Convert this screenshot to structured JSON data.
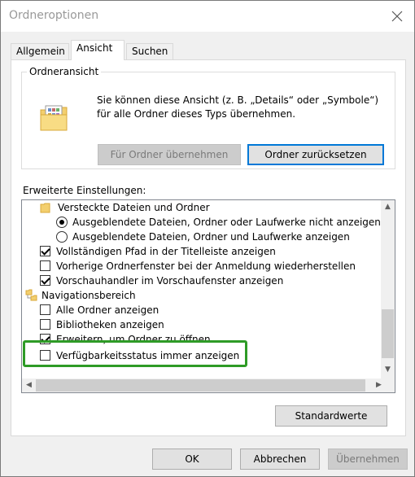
{
  "window": {
    "title": "Ordneroptionen"
  },
  "tabs": [
    {
      "label": "Allgemein"
    },
    {
      "label": "Ansicht"
    },
    {
      "label": "Suchen"
    }
  ],
  "folder_view": {
    "label": "Ordneransicht",
    "desc1": "Sie können diese Ansicht (z. B. „Details“ oder „Symbole“)",
    "desc2": "für alle Ordner dieses Typs übernehmen.",
    "apply_btn": "Für Ordner übernehmen",
    "reset_btn": "Ordner zurücksetzen"
  },
  "advanced": {
    "label": "Erweiterte Einstellungen:",
    "items": [
      {
        "type": "folder",
        "text": "Versteckte Dateien und Ordner"
      },
      {
        "type": "radio",
        "checked": true,
        "text": "Ausgeblendete Dateien, Ordner oder Laufwerke nicht anzeigen"
      },
      {
        "type": "radio",
        "checked": false,
        "text": "Ausgeblendete Dateien, Ordner und Laufwerke anzeigen"
      },
      {
        "type": "checkbox",
        "checked": true,
        "text": "Vollständigen Pfad in der Titelleiste anzeigen"
      },
      {
        "type": "checkbox",
        "checked": false,
        "text": "Vorherige Ordnerfenster bei der Anmeldung wiederherstellen"
      },
      {
        "type": "checkbox",
        "checked": true,
        "text": "Vorschauhandler im Vorschaufenster anzeigen"
      },
      {
        "type": "folder",
        "text": "Navigationsbereich"
      },
      {
        "type": "checkbox",
        "checked": false,
        "text": "Alle Ordner anzeigen"
      },
      {
        "type": "checkbox",
        "checked": false,
        "text": "Bibliotheken anzeigen"
      },
      {
        "type": "checkbox",
        "checked": true,
        "text": "Erweitern, um Ordner zu öffnen"
      },
      {
        "type": "checkbox",
        "checked": false,
        "text": "Verfügbarkeitsstatus immer anzeigen"
      }
    ]
  },
  "buttons": {
    "defaults": "Standardwerte",
    "ok": "OK",
    "cancel": "Abbrechen",
    "apply": "Übernehmen"
  },
  "colors": {
    "highlight": "#2e9b26",
    "focus": "#0078d7"
  }
}
